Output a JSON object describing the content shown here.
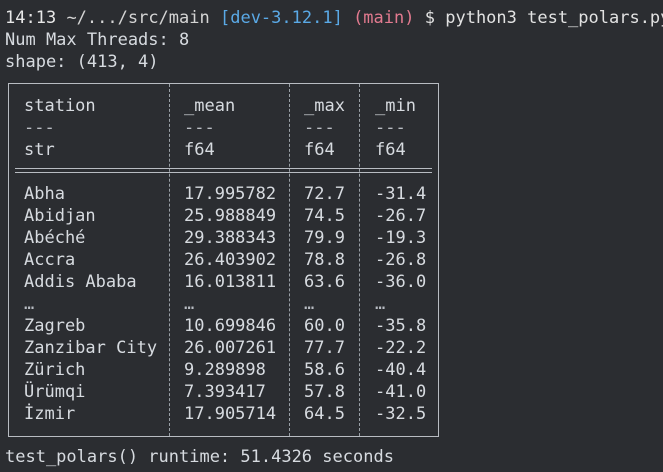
{
  "prompt": {
    "time": "14:13",
    "path": "~/.../src/main",
    "venv": "[dev-3.12.1]",
    "branch": "(main)",
    "symbol": "$",
    "command": "python3 test_polars.py"
  },
  "output": {
    "threads_line": "Num Max Threads: 8",
    "shape_line": "shape: (413, 4)",
    "runtime_line": "test_polars() runtime: 51.4326 seconds"
  },
  "table": {
    "columns": [
      {
        "name": "station",
        "sep": "---",
        "dtype": "str"
      },
      {
        "name": "_mean",
        "sep": "---",
        "dtype": "f64"
      },
      {
        "name": "_max",
        "sep": "---",
        "dtype": "f64"
      },
      {
        "name": "_min",
        "sep": "---",
        "dtype": "f64"
      }
    ],
    "rows": [
      [
        "Abha",
        "17.995782",
        "72.7",
        "-31.4"
      ],
      [
        "Abidjan",
        "25.988849",
        "74.5",
        "-26.7"
      ],
      [
        "Abéché",
        "29.388343",
        "79.9",
        "-19.3"
      ],
      [
        "Accra",
        "26.403902",
        "78.8",
        "-26.8"
      ],
      [
        "Addis Ababa",
        "16.013811",
        "63.6",
        "-36.0"
      ],
      [
        "…",
        "…",
        "…",
        "…"
      ],
      [
        "Zagreb",
        "10.699846",
        "60.0",
        "-35.8"
      ],
      [
        "Zanzibar City",
        "26.007261",
        "77.7",
        "-22.2"
      ],
      [
        "Zürich",
        "9.289898",
        "58.6",
        "-40.4"
      ],
      [
        "Ürümqi",
        "7.393417",
        "57.8",
        "-41.0"
      ],
      [
        "İzmir",
        "17.905714",
        "64.5",
        "-32.5"
      ]
    ]
  }
}
